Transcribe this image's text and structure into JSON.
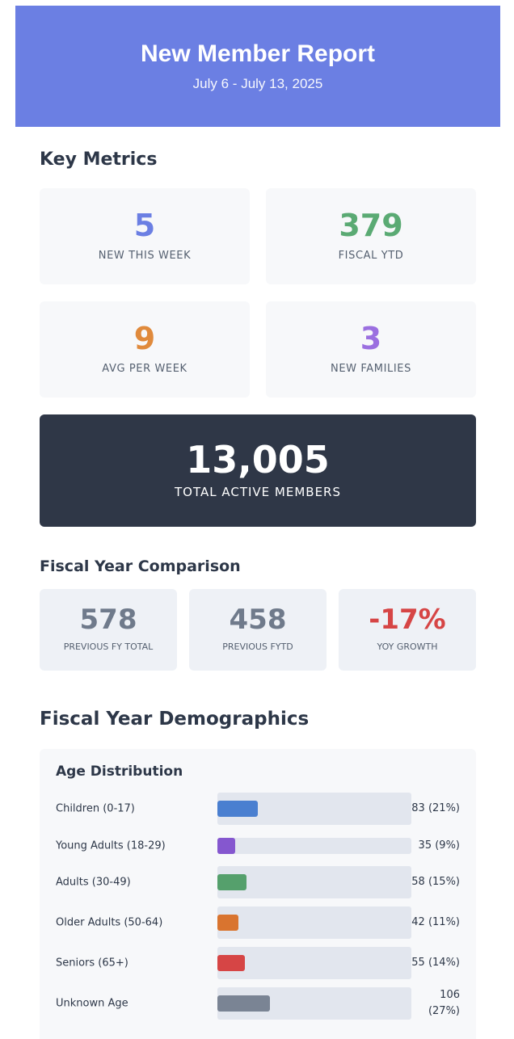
{
  "header": {
    "title": "New Member Report",
    "subtitle": "July 6 - July 13, 2025",
    "background": "#6b7fe3"
  },
  "key_metrics": {
    "title": "Key Metrics",
    "cards": [
      {
        "value": "5",
        "label": "NEW THIS WEEK",
        "color": "#6b7fe3"
      },
      {
        "value": "379",
        "label": "FISCAL YTD",
        "color": "#5aaa73"
      },
      {
        "value": "9",
        "label": "AVG PER WEEK",
        "color": "#e08a3c"
      },
      {
        "value": "3",
        "label": "NEW FAMILIES",
        "color": "#9b6fe0"
      }
    ],
    "total": {
      "value": "13,005",
      "label": "TOTAL ACTIVE MEMBERS",
      "background": "#2f3747"
    }
  },
  "fiscal_year": {
    "title": "Fiscal Year Comparison",
    "cards": [
      {
        "value": "578",
        "label": "PREVIOUS FY TOTAL",
        "color": "#6f7a8b"
      },
      {
        "value": "458",
        "label": "PREVIOUS FYTD",
        "color": "#6f7a8b"
      },
      {
        "value": "-17%",
        "label": "YOY GROWTH",
        "color": "#d64545"
      }
    ]
  },
  "demographics": {
    "title": "Fiscal Year Demographics",
    "age": {
      "title": "Age Distribution",
      "rows": [
        {
          "label": "Children (0-17)",
          "value": "83 (21%)",
          "fraction": 0.21,
          "color": "#4a7fd0"
        },
        {
          "label": "Young Adults (18-29)",
          "value": "35 (9%)",
          "fraction": 0.09,
          "color": "#8557cf"
        },
        {
          "label": "Adults (30-49)",
          "value": "58 (15%)",
          "fraction": 0.15,
          "color": "#55a06c"
        },
        {
          "label": "Older Adults (50-64)",
          "value": "42 (11%)",
          "fraction": 0.11,
          "color": "#d9742f"
        },
        {
          "label": "Seniors (65+)",
          "value": "55 (14%)",
          "fraction": 0.14,
          "color": "#d64545"
        },
        {
          "label": "Unknown Age",
          "value": "106 (27%)",
          "fraction": 0.27,
          "color": "#7a8494"
        }
      ]
    }
  }
}
